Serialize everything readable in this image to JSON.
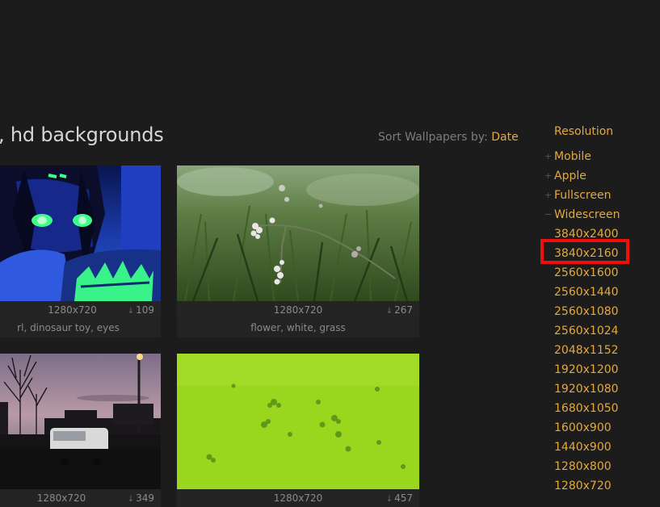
{
  "page": {
    "title": ", hd backgrounds"
  },
  "sort": {
    "label": "Sort Wallpapers by:",
    "value": "Date"
  },
  "wallpapers": [
    {
      "resolution": "1280x720",
      "downloads": "109",
      "tags": "rl, dinosaur toy, eyes"
    },
    {
      "resolution": "1280x720",
      "downloads": "267",
      "tags": "flower, white, grass"
    },
    {
      "resolution": "1280x720",
      "downloads": "349"
    },
    {
      "resolution": "1280x720",
      "downloads": "457"
    }
  ],
  "sidebar": {
    "heading": "Resolution",
    "categories": [
      {
        "label": "Mobile",
        "marker": "+"
      },
      {
        "label": "Apple",
        "marker": "+"
      },
      {
        "label": "Fullscreen",
        "marker": "+"
      },
      {
        "label": "Widescreen",
        "marker": "−"
      }
    ],
    "resolutions": [
      "3840x2400",
      "3840x2160",
      "2560x1600",
      "2560x1440",
      "2560x1080",
      "2560x1024",
      "2048x1152",
      "1920x1200",
      "1920x1080",
      "1680x1050",
      "1600x900",
      "1440x900",
      "1280x800",
      "1280x720"
    ],
    "highlighted": "3840x2160"
  },
  "colors": {
    "background": "#1c1c1c",
    "accent": "#e2a941",
    "highlight_box": "#f20d0d"
  }
}
